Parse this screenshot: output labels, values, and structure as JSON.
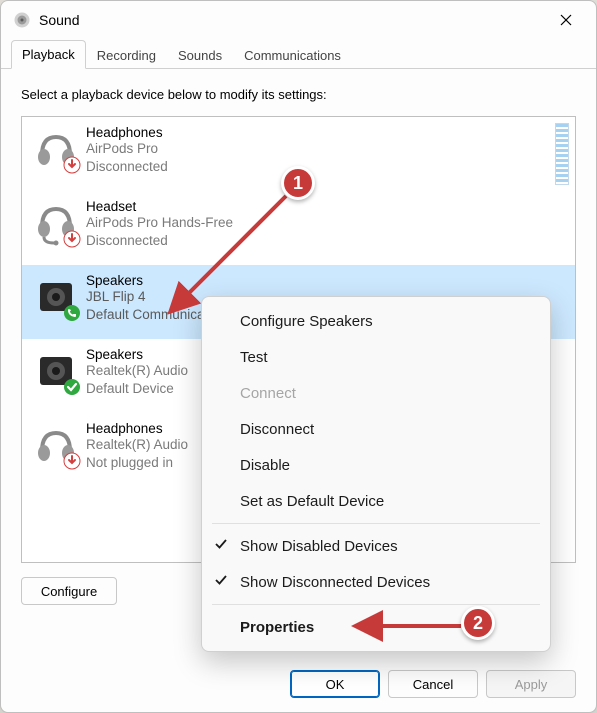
{
  "window": {
    "title": "Sound"
  },
  "tabs": [
    {
      "label": "Playback",
      "active": true
    },
    {
      "label": "Recording",
      "active": false
    },
    {
      "label": "Sounds",
      "active": false
    },
    {
      "label": "Communications",
      "active": false
    }
  ],
  "instruction": "Select a playback device below to modify its settings:",
  "devices": [
    {
      "name": "Headphones",
      "line2": "AirPods Pro",
      "line3": "Disconnected",
      "icon": "headphones",
      "overlay": "disconnected",
      "selected": false,
      "meter": false
    },
    {
      "name": "Headset",
      "line2": "AirPods Pro Hands-Free",
      "line3": "Disconnected",
      "icon": "headset",
      "overlay": "disconnected",
      "selected": false,
      "meter": false
    },
    {
      "name": "Speakers",
      "line2": "JBL Flip 4",
      "line3": "Default Communication Device",
      "icon": "speaker-dark",
      "overlay": "phone-green",
      "selected": true,
      "meter": true
    },
    {
      "name": "Speakers",
      "line2": "Realtek(R) Audio",
      "line3": "Default Device",
      "icon": "speaker-dark",
      "overlay": "check-green",
      "selected": false,
      "meter": true
    },
    {
      "name": "Headphones",
      "line2": "Realtek(R) Audio",
      "line3": "Not plugged in",
      "icon": "headphones",
      "overlay": "disconnected",
      "selected": false,
      "meter": false
    }
  ],
  "context_menu": [
    {
      "label": "Configure Speakers",
      "type": "item"
    },
    {
      "label": "Test",
      "type": "item"
    },
    {
      "label": "Connect",
      "type": "item",
      "disabled": true
    },
    {
      "label": "Disconnect",
      "type": "item"
    },
    {
      "label": "Disable",
      "type": "item"
    },
    {
      "label": "Set as Default Device",
      "type": "item"
    },
    {
      "type": "sep"
    },
    {
      "label": "Show Disabled Devices",
      "type": "item",
      "checked": true
    },
    {
      "label": "Show Disconnected Devices",
      "type": "item",
      "checked": true
    },
    {
      "type": "sep"
    },
    {
      "label": "Properties",
      "type": "item",
      "bold": true
    }
  ],
  "buttons": {
    "configure": "Configure",
    "ok": "OK",
    "cancel": "Cancel",
    "apply": "Apply"
  },
  "annotations": {
    "badge1": "1",
    "badge2": "2"
  }
}
